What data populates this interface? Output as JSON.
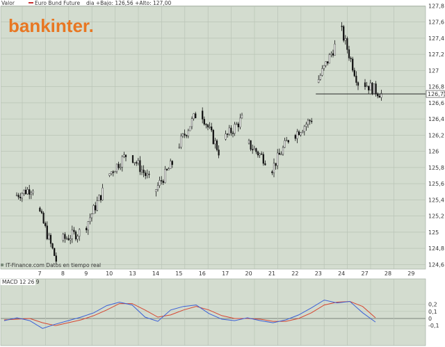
{
  "header": {
    "valor_label": "Valor",
    "instrument": "Euro Bund Future",
    "stats": "dia +Bajo: 126,56 +Alto: 127,00"
  },
  "logo_text": "bankinter.",
  "source_note": "IT-Finance.com  Datos en tiempo real",
  "colors": {
    "panel_bg": "#d3dccf",
    "grid": "#b9c3b6",
    "candle": "#111111",
    "macd_line": "#3a5fd6",
    "signal_line": "#d64530",
    "logo": "#e87722",
    "last_price_bg": "#ffffff"
  },
  "chart_data": [
    {
      "type": "candlestick",
      "title": "Euro Bund Future",
      "x_tick_labels": [
        "7",
        "8",
        "9",
        "10",
        "13",
        "14",
        "15",
        "16",
        "17",
        "20",
        "21",
        "22",
        "23",
        "24",
        "27",
        "28",
        "29"
      ],
      "y_tick_labels": [
        "127,8",
        "127,6",
        "127,4",
        "127,2",
        "127",
        "126,8",
        "126,6",
        "126,4",
        "126,2",
        "126",
        "125,8",
        "125,6",
        "125,4",
        "125,2",
        "125",
        "124,8",
        "124,6"
      ],
      "ylim": [
        124.5,
        127.85
      ],
      "last_price": 126.71,
      "last_price_label": "126,71",
      "grid": true,
      "approx_path": [
        {
          "day": "7",
          "start": 125.45,
          "end": 125.55
        },
        {
          "day": "8",
          "start": 125.3,
          "end": 124.65
        },
        {
          "day": "9",
          "start": 124.9,
          "end": 125.0
        },
        {
          "day": "10",
          "start": 125.05,
          "end": 125.5
        },
        {
          "day": "13",
          "start": 125.7,
          "end": 125.95
        },
        {
          "day": "14",
          "start": 125.95,
          "end": 125.65
        },
        {
          "day": "15",
          "start": 125.5,
          "end": 125.85
        },
        {
          "day": "16",
          "start": 126.05,
          "end": 126.45
        },
        {
          "day": "17",
          "start": 126.5,
          "end": 126.0
        },
        {
          "day": "20",
          "start": 126.15,
          "end": 126.4
        },
        {
          "day": "21",
          "start": 126.1,
          "end": 125.9
        },
        {
          "day": "22",
          "start": 125.75,
          "end": 126.15
        },
        {
          "day": "23",
          "start": 126.2,
          "end": 126.4
        },
        {
          "day": "24",
          "start": 126.85,
          "end": 127.3
        },
        {
          "day": "27",
          "start": 127.55,
          "end": 126.85
        },
        {
          "day": "28",
          "start": 126.85,
          "end": 126.71
        }
      ]
    },
    {
      "type": "line",
      "title": "MACD 12 26 9",
      "y_tick_labels": [
        "0,2",
        "0,1",
        "0",
        "-0,1"
      ],
      "ylim": [
        -0.19,
        0.27
      ],
      "series": [
        {
          "name": "MACD",
          "values": [
            -0.03,
            0.01,
            -0.03,
            -0.14,
            -0.08,
            -0.03,
            0.02,
            0.08,
            0.18,
            0.23,
            0.19,
            0.02,
            -0.04,
            0.12,
            0.17,
            0.19,
            0.07,
            -0.01,
            -0.03,
            0.01,
            -0.03,
            -0.06,
            -0.02,
            0.05,
            0.15,
            0.26,
            0.22,
            0.24,
            0.08,
            -0.05
          ]
        },
        {
          "name": "Signal",
          "values": [
            -0.02,
            -0.01,
            0.0,
            -0.06,
            -0.1,
            -0.06,
            -0.02,
            0.04,
            0.12,
            0.21,
            0.21,
            0.12,
            0.02,
            0.05,
            0.12,
            0.17,
            0.12,
            0.04,
            0.0,
            0.0,
            -0.01,
            -0.04,
            -0.04,
            0.0,
            0.08,
            0.19,
            0.23,
            0.24,
            0.17,
            0.01
          ]
        }
      ]
    }
  ]
}
